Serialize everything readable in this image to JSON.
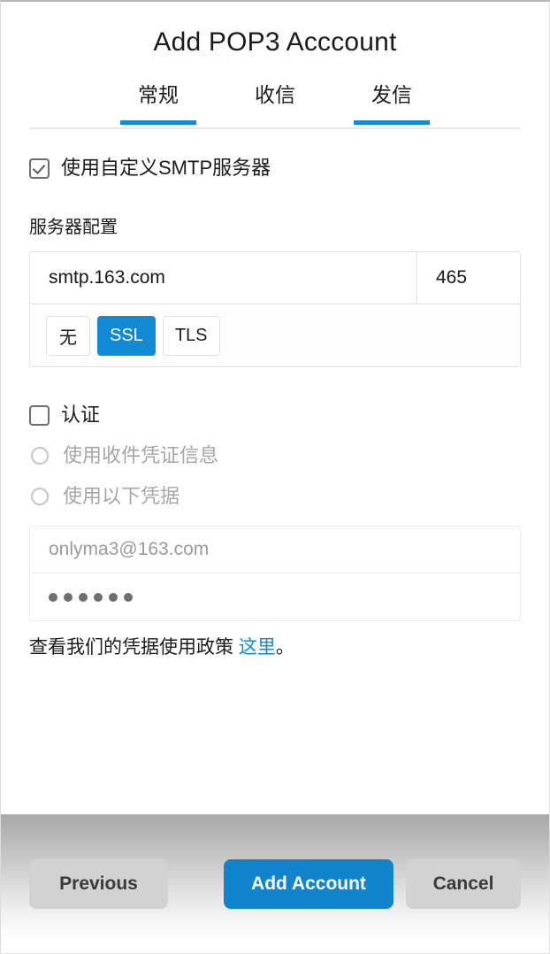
{
  "window": {
    "title": "Add POP3 Acccount"
  },
  "tabs": [
    {
      "label": "常规",
      "active": true
    },
    {
      "label": "收信",
      "active": false
    },
    {
      "label": "发信",
      "active": true
    }
  ],
  "smtp_toggle": {
    "label": "使用自定义SMTP服务器",
    "checked": true
  },
  "server": {
    "section_label": "服务器配置",
    "host": "smtp.163.com",
    "port": "465",
    "security_options": [
      {
        "label": "无",
        "selected": false
      },
      {
        "label": "SSL",
        "selected": true
      },
      {
        "label": "TLS",
        "selected": false
      }
    ]
  },
  "auth": {
    "label": "认证",
    "checked": false,
    "options": [
      {
        "label": "使用收件凭证信息",
        "selected": false
      },
      {
        "label": "使用以下凭据",
        "selected": false
      }
    ],
    "username": "onlyma3@163.com",
    "password_dots": 6
  },
  "policy": {
    "text_before": "查看我们的凭据使用政策 ",
    "link": "这里",
    "text_after": "。"
  },
  "footer": {
    "previous": "Previous",
    "add_account": "Add Account",
    "cancel": "Cancel"
  },
  "colors": {
    "accent": "#1189d4",
    "primary_button": "#1284cd",
    "muted_text": "#a6a6a6",
    "placeholder_text": "#9a9a9a"
  }
}
